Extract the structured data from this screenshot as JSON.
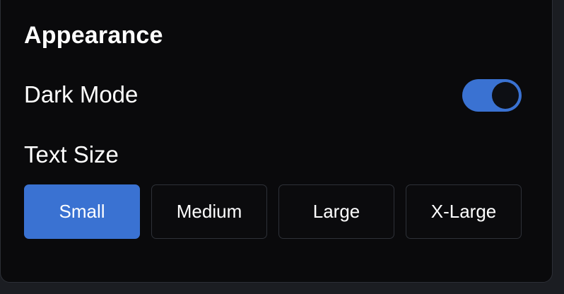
{
  "section": {
    "title": "Appearance"
  },
  "dark_mode": {
    "label": "Dark Mode",
    "enabled": true
  },
  "text_size": {
    "label": "Text Size",
    "options": [
      {
        "label": "Small",
        "selected": true
      },
      {
        "label": "Medium",
        "selected": false
      },
      {
        "label": "Large",
        "selected": false
      },
      {
        "label": "X-Large",
        "selected": false
      }
    ]
  },
  "colors": {
    "accent": "#3a72d2",
    "panel_background": "#0a0a0c",
    "text": "#ffffff"
  }
}
